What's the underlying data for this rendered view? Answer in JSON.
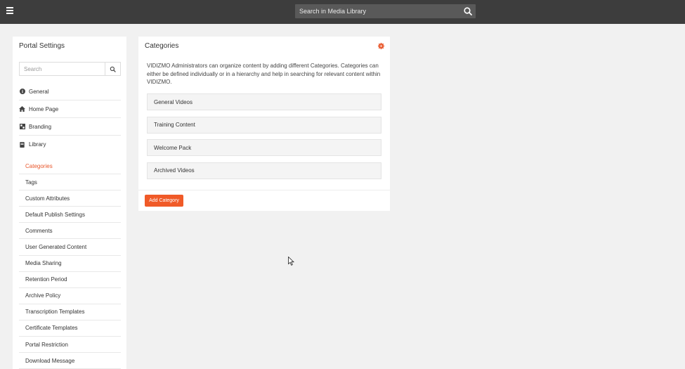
{
  "topbar": {
    "search_placeholder": "Search in Media Library",
    "menu_icon": "hamburger-icon",
    "search_icon": "search-icon"
  },
  "sidebar": {
    "title": "Portal Settings",
    "search_placeholder": "Search",
    "items": [
      {
        "label": "General",
        "icon": "info-circle-icon"
      },
      {
        "label": "Home Page",
        "icon": "home-icon"
      },
      {
        "label": "Branding",
        "icon": "branding-icon"
      },
      {
        "label": "Library",
        "icon": "book-icon"
      }
    ],
    "library_items": [
      {
        "label": "Categories",
        "active": true
      },
      {
        "label": "Tags"
      },
      {
        "label": "Custom Attributes"
      },
      {
        "label": "Default Publish Settings"
      },
      {
        "label": "Comments"
      },
      {
        "label": "User Generated Content"
      },
      {
        "label": "Media Sharing"
      },
      {
        "label": "Retention Period"
      },
      {
        "label": "Archive Policy"
      },
      {
        "label": "Transcription Templates"
      },
      {
        "label": "Certificate Templates"
      },
      {
        "label": "Portal Restriction"
      },
      {
        "label": "Download Message"
      }
    ]
  },
  "panel": {
    "title": "Categories",
    "description": "VIDIZMO Administrators can organize content by adding different Categories. Categories can either be defined individually or in a hierarchy and help in searching for relevant content within VIDIZMO.",
    "categories": [
      "General Videos",
      "Training Content",
      "Welcome Pack",
      "Archived Videos"
    ],
    "add_button": "Add Category"
  },
  "colors": {
    "accent": "#f05a28",
    "active_text": "#e8562a",
    "topbar": "#3d3d3d"
  }
}
